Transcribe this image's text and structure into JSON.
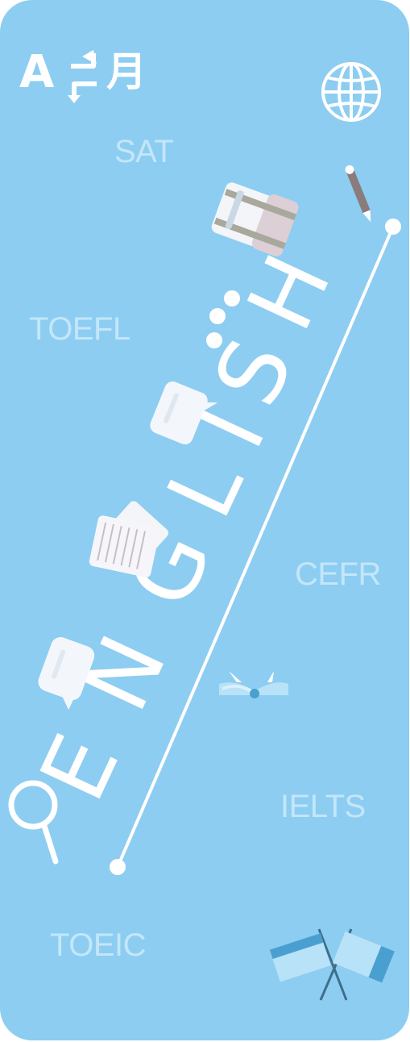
{
  "banner": {
    "word_letters": [
      "E",
      "N",
      "G",
      "L",
      "I",
      "S",
      "H"
    ],
    "exams": [
      "SAT",
      "TOEFL",
      "CEFR",
      "IELTS",
      "TOEIC"
    ],
    "translate_icon": {
      "latin_glyph": "A",
      "kanji_glyph": "月"
    }
  },
  "colors": {
    "background": "#8dcdf1",
    "exam_text": "#c4e6fa",
    "white": "#ffffff",
    "accent_blue": "#4a9fd1",
    "light_blue": "#b8e2f7"
  },
  "icons": [
    "translate-icon",
    "globe-icon",
    "pencil-icon",
    "backpack-icon",
    "speech-bubble-icon",
    "notebook-icon",
    "open-book-icon",
    "magnifier-icon",
    "crossed-flags-icon"
  ]
}
